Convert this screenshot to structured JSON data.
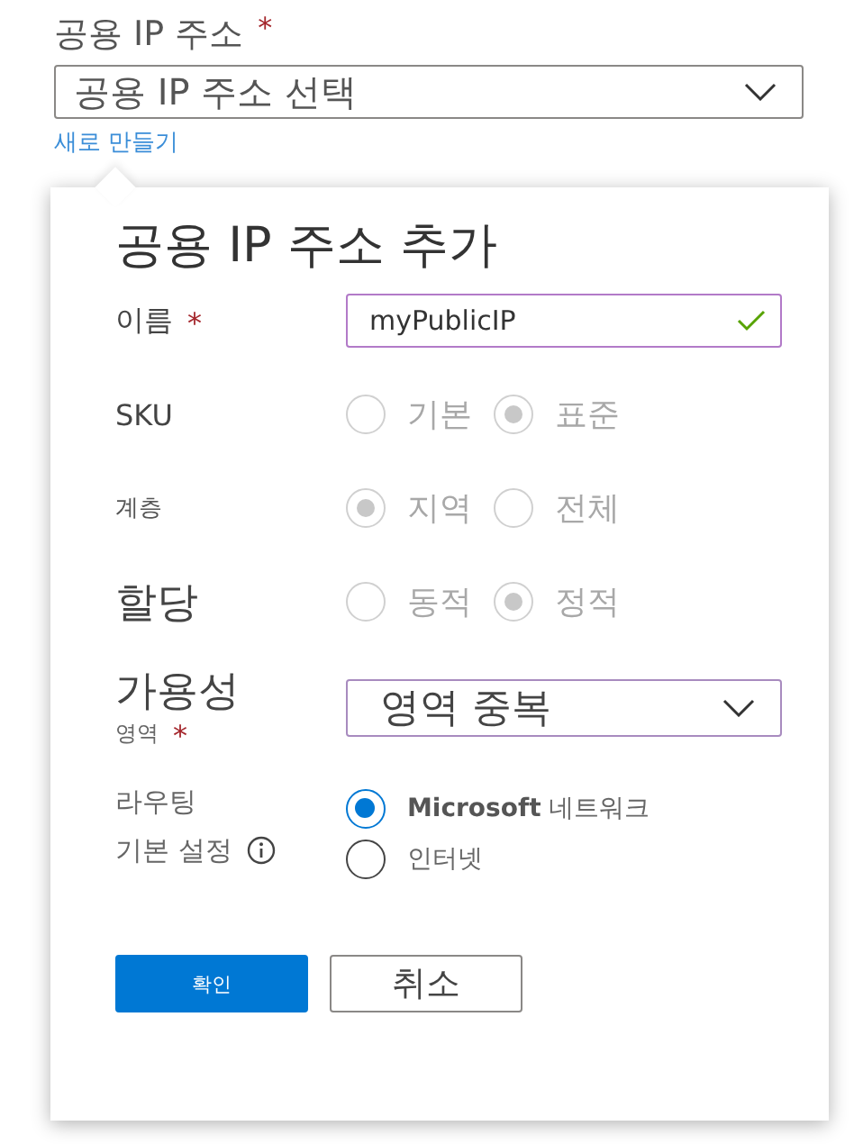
{
  "public_ip": {
    "label": "공용 IP 주소",
    "required_mark": "*",
    "select": {
      "value": "공용 IP 주소 선택"
    },
    "create_link": "새로 만들기"
  },
  "dialog": {
    "title": "공용 IP 주소 추가",
    "fields": [
      {
        "kind": "text",
        "label": "이름",
        "required_mark": "*",
        "value": "myPublicIP",
        "valid": true
      },
      {
        "kind": "radio_row",
        "label": "SKU",
        "disabled": true,
        "options": [
          {
            "label": "기본",
            "selected": false
          },
          {
            "label": "표준",
            "selected": true
          }
        ]
      },
      {
        "kind": "radio_row",
        "label": "계층",
        "disabled": true,
        "options": [
          {
            "label": "지역",
            "selected": true
          },
          {
            "label": "전체",
            "selected": false
          }
        ]
      },
      {
        "kind": "radio_row",
        "label": "할당",
        "disabled": true,
        "options": [
          {
            "label": "동적",
            "selected": false
          },
          {
            "label": "정적",
            "selected": true
          }
        ]
      },
      {
        "kind": "select",
        "label": "가용성",
        "sublabel": "영역",
        "required_mark": "*",
        "value": "영역 중복"
      },
      {
        "kind": "radio_list",
        "label": "라우팅",
        "sublabel": "기본 설정",
        "info": true,
        "disabled": false,
        "options": [
          {
            "label": "**Microsoft** 네트워크",
            "selected": true
          },
          {
            "label": "인터넷",
            "selected": false
          }
        ]
      }
    ],
    "buttons": [
      {
        "label": "확인",
        "primary": true
      },
      {
        "label": "취소",
        "primary": false
      }
    ]
  }
}
